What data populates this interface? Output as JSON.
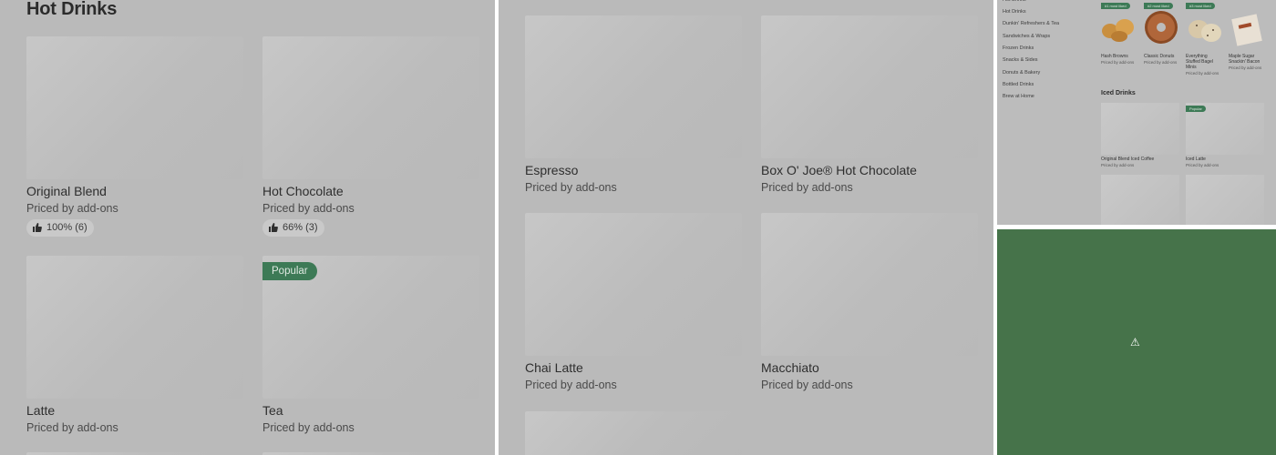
{
  "panel1": {
    "section_title": "Hot Drinks",
    "items": [
      {
        "name": "Original Blend",
        "price": "Priced by add-ons",
        "rating": "100% (6)"
      },
      {
        "name": "Hot Chocolate",
        "price": "Priced by add-ons",
        "rating": "66% (3)"
      },
      {
        "name": "Latte",
        "price": "Priced by add-ons"
      },
      {
        "name": "Tea",
        "price": "Priced by add-ons",
        "badge": "Popular"
      }
    ]
  },
  "panel2": {
    "items": [
      {
        "name": "Espresso",
        "price": "Priced by add-ons"
      },
      {
        "name": "Box O' Joe® Hot Chocolate",
        "price": "Priced by add-ons"
      },
      {
        "name": "Chai Latte",
        "price": "Priced by add-ons"
      },
      {
        "name": "Macchiato",
        "price": "Priced by add-ons"
      }
    ]
  },
  "panel3": {
    "nav": [
      "Hot Drinks",
      "Dunkin' Refreshers & Tea",
      "Sandwiches & Wraps",
      "Frozen Drinks",
      "Snacks & Sides",
      "Donuts & Bakery",
      "Bottled Drinks",
      "Brew at Home"
    ],
    "top_items": [
      {
        "name": "Hash Browns",
        "price": "Priced by add-ons",
        "badge": "#1 most liked"
      },
      {
        "name": "Classic Donuts",
        "price": "Priced by add-ons",
        "badge": "#2 most liked"
      },
      {
        "name": "Everything Stuffed Bagel Minis",
        "price": "Priced by add-ons",
        "badge": "#3 most liked"
      },
      {
        "name": "Maple Sugar Snackin' Bacon",
        "price": "Priced by add-ons"
      }
    ],
    "section_title": "Iced Drinks",
    "iced_items": [
      {
        "name": "Original Blend Iced Coffee",
        "price": "Priced by add-ons"
      },
      {
        "name": "Iced Latte",
        "price": "Priced by add-ons",
        "badge": "Popular"
      }
    ]
  },
  "panel4": {
    "icon": "warning-icon",
    "glyph": "⚠",
    "color": "#46734a"
  }
}
